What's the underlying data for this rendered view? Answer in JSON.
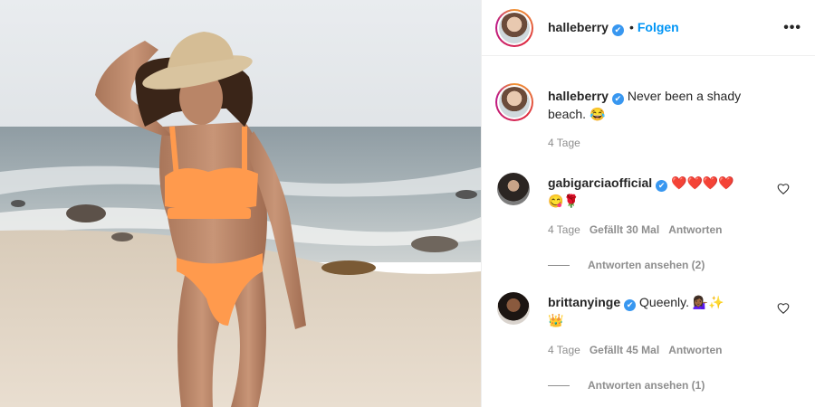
{
  "post": {
    "username": "halleberry",
    "follow_label": "Folgen",
    "more_icon": "•••",
    "verified_icon": "✔"
  },
  "caption": {
    "username": "halleberry",
    "text_line1": "Never been a shady",
    "text_line2": "beach.",
    "emoji": "😂",
    "time": "4 Tage"
  },
  "comments": [
    {
      "username": "gabigarciaofficial",
      "emoji_line1": "❤️❤️❤️❤️",
      "emoji_line2": "😋🌹",
      "time": "4 Tage",
      "likes": "Gefällt 30 Mal",
      "reply_label": "Antworten",
      "view_replies": "Antworten ansehen (2)"
    },
    {
      "username": "brittanyinge",
      "text": "Queenly.",
      "emoji_line1": "💁🏾‍♀️✨",
      "emoji_line2": "👑",
      "time": "4 Tage",
      "likes": "Gefällt 45 Mal",
      "reply_label": "Antworten",
      "view_replies": "Antworten ansehen (1)"
    }
  ],
  "colors": {
    "accent": "#0095f6",
    "verified": "#3897f0",
    "meta": "#8e8e8e",
    "swimsuit": "#ff9a4d"
  }
}
